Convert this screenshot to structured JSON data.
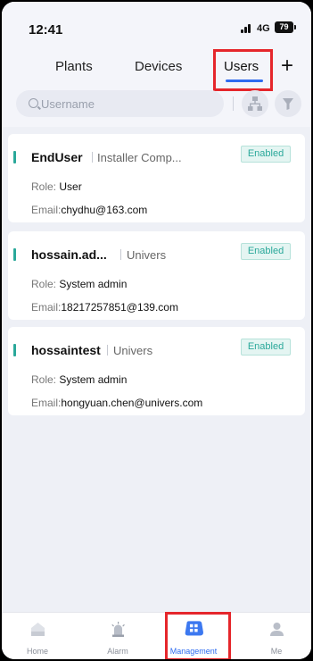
{
  "status_bar": {
    "time": "12:41",
    "network": "4G",
    "battery": "79"
  },
  "tabs": [
    {
      "label": "Plants"
    },
    {
      "label": "Devices"
    },
    {
      "label": "Users",
      "active": true
    }
  ],
  "add_button": {
    "label": "+"
  },
  "search": {
    "placeholder": "Username"
  },
  "users": [
    {
      "name": "EndUser",
      "company": "Installer Comp...",
      "status": "Enabled",
      "role_label": "Role:",
      "role": "User",
      "email_label": "Email:",
      "email": "chydhu@163.com"
    },
    {
      "name": "hossain.ad...",
      "company": "Univers",
      "status": "Enabled",
      "role_label": "Role:",
      "role": "System admin",
      "email_label": "Email:",
      "email": "18217257851@139.com"
    },
    {
      "name": "hossaintest",
      "company": "Univers",
      "status": "Enabled",
      "role_label": "Role:",
      "role": "System admin",
      "email_label": "Email:",
      "email": "hongyuan.chen@univers.com"
    }
  ],
  "bottom_nav": [
    {
      "label": "Home",
      "icon": "home-icon"
    },
    {
      "label": "Alarm",
      "icon": "alarm-icon"
    },
    {
      "label": "Management",
      "icon": "management-icon",
      "active": true
    },
    {
      "label": "Me",
      "icon": "me-icon"
    }
  ],
  "colors": {
    "accent": "#2e6cf0",
    "status_green": "#2aa89a",
    "highlight_red": "#e5262b",
    "page_bg": "#eef0f6"
  }
}
